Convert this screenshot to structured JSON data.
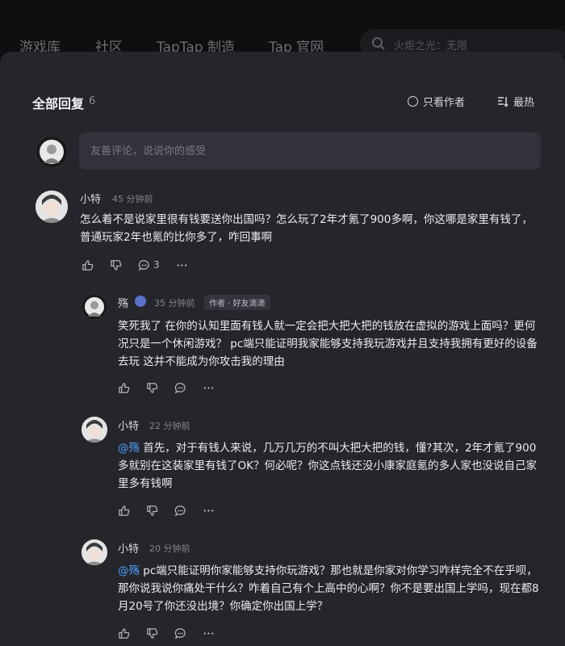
{
  "nav": {
    "items": [
      "游戏库",
      "社区",
      "TapTap 制造",
      "Tap 官网"
    ],
    "search_placeholder": "火炬之光：无限"
  },
  "header": {
    "title": "全部回复",
    "count": "6",
    "author_only": "只看作者",
    "sort": "最热"
  },
  "input": {
    "placeholder": "友善评论，说说你的感受"
  },
  "comments": [
    {
      "user": "小特",
      "time": "45 分钟前",
      "text": "怎么着不是说家里很有钱要送你出国吗？怎么玩了2年才氪了900多啊，你这哪是家里有钱了，普通玩家2年也氪的比你多了，咋回事啊",
      "reply_count": "3"
    }
  ],
  "replies": [
    {
      "user": "殇",
      "time": "35 分钟前",
      "badge": "作者 · 好友滴滴",
      "mention": "",
      "text": "笑死我了 在你的认知里面有钱人就一定会把大把大把的钱放在虚拟的游戏上面吗？更何况只是一个休闲游戏？ pc端只能证明我家能够支持我玩游戏并且支持我拥有更好的设备去玩 这并不能成为你攻击我的理由"
    },
    {
      "user": "小特",
      "time": "22 分钟前",
      "badge": "",
      "mention": "@殇",
      "text": " 首先，对于有钱人来说，几万几万的不叫大把大把的钱，懂?其次，2年才氪了900多就别在这装家里有钱了OK？何必呢？你这点钱还没小康家庭氪的多人家也没说自己家里多有钱啊"
    },
    {
      "user": "小特",
      "time": "20 分钟前",
      "badge": "",
      "mention": "@殇",
      "text": " pc端只能证明你家能够支持你玩游戏？那也就是你家对你学习咋样完全不在乎呗，那你说我说你痛处干什么？咋着自己有个上高中的心啊？你不是要出国上学吗，现在都8月20号了你还没出境？你确定你出国上学？"
    }
  ],
  "colors": {
    "mention": "#4aa3ff",
    "panel": "#25262c",
    "input": "#31323a"
  }
}
